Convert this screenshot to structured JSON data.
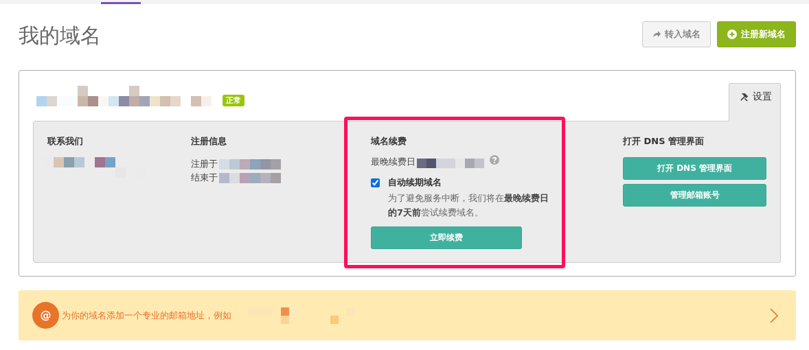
{
  "page_title": "我的域名",
  "actions": [
    {
      "kind": "transfer",
      "label": "转入域名"
    },
    {
      "kind": "register",
      "label": "注册新域名"
    }
  ],
  "domain": {
    "status": "正常"
  },
  "settings_tab": {
    "label": "设置",
    "selected": true
  },
  "contact": {
    "title": "联系我们"
  },
  "registration": {
    "title": "注册信息",
    "rows": [
      {
        "label": "注册于"
      },
      {
        "label": "结束于"
      }
    ]
  },
  "renewal": {
    "title": "域名续费",
    "latest_label": "最晚续费日",
    "auto_renew": {
      "label": "自动续期域名",
      "checked": true
    },
    "description": "为了避免服务中断，我们将在**最晚续费日的7天前**尝试续费域名。",
    "button": "立即续费"
  },
  "dns": {
    "title": "打开 DNS 管理界面",
    "buttons": [
      "打开 DNS 管理界面",
      "管理邮箱账号"
    ]
  },
  "banner": {
    "icon": "@",
    "text": "为你的域名添加一个专业的邮箱地址，例如"
  }
}
